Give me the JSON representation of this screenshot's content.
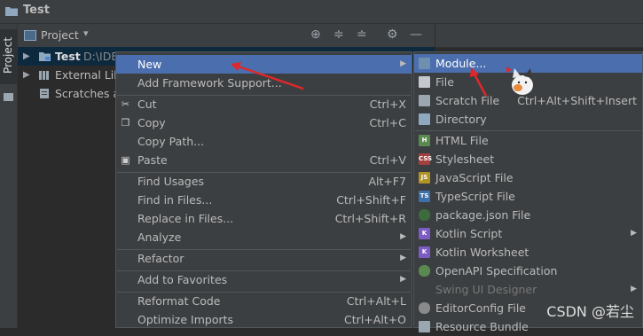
{
  "window": {
    "title": "Test"
  },
  "sidebar": {
    "project_tab": "Project"
  },
  "panel": {
    "label": "Project"
  },
  "tree": {
    "root_name": "Test",
    "root_path": "D:\\IDEAWorkspace\\Test",
    "external": "External Libraries",
    "scratches": "Scratches and Consoles"
  },
  "menu": {
    "new": "New",
    "add_framework": "Add Framework Support...",
    "cut": "Cut",
    "cut_sc": "Ctrl+X",
    "copy": "Copy",
    "copy_sc": "Ctrl+C",
    "copy_path": "Copy Path...",
    "paste": "Paste",
    "paste_sc": "Ctrl+V",
    "find_usages": "Find Usages",
    "find_usages_sc": "Alt+F7",
    "find_in_files": "Find in Files...",
    "find_in_files_sc": "Ctrl+Shift+F",
    "replace_in_files": "Replace in Files...",
    "replace_in_files_sc": "Ctrl+Shift+R",
    "analyze": "Analyze",
    "refactor": "Refactor",
    "add_to_favorites": "Add to Favorites",
    "reformat_code": "Reformat Code",
    "reformat_code_sc": "Ctrl+Alt+L",
    "optimize_imports": "Optimize Imports",
    "optimize_imports_sc": "Ctrl+Alt+O"
  },
  "submenu": {
    "module": "Module...",
    "file": "File",
    "scratch_file": "Scratch File",
    "scratch_file_sc": "Ctrl+Alt+Shift+Insert",
    "directory": "Directory",
    "html_file": "HTML File",
    "stylesheet": "Stylesheet",
    "javascript_file": "JavaScript File",
    "typescript_file": "TypeScript File",
    "package_json": "package.json File",
    "kotlin_script": "Kotlin Script",
    "kotlin_worksheet": "Kotlin Worksheet",
    "openapi": "OpenAPI Specification",
    "swing_ui": "Swing UI Designer",
    "editorconfig": "EditorConfig File",
    "resource_bundle": "Resource Bundle"
  },
  "icons": {
    "html": "H",
    "css": "CSS",
    "js": "JS",
    "ts": "TS",
    "kt": "K"
  },
  "watermark": "CSDN @若尘",
  "colors": {
    "highlight": "#4b6eaf",
    "annotation": "#e0282a"
  }
}
